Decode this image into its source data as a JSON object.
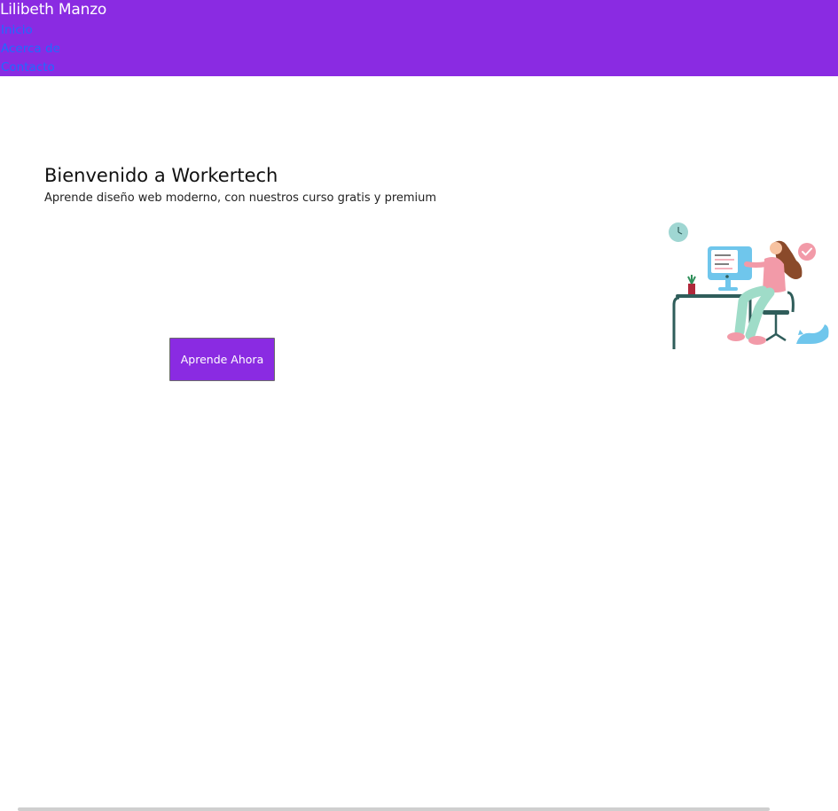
{
  "header": {
    "brand": "Lilibeth Manzo",
    "nav": [
      {
        "label": "Inicio"
      },
      {
        "label": "Acerca de"
      },
      {
        "label": "Contacto"
      }
    ]
  },
  "hero": {
    "title": "Bienvenido a Workertech",
    "subtitle": "Aprende diseño web moderno, con nuestros curso gratis y premium",
    "cta_label": "Aprende Ahora",
    "illustration_icon": "woman-at-computer-illustration"
  },
  "colors": {
    "brand_purple": "#8a2be2",
    "nav_link": "#1e6bff",
    "teal": "#2f5d5a",
    "pink": "#f29aa8"
  }
}
